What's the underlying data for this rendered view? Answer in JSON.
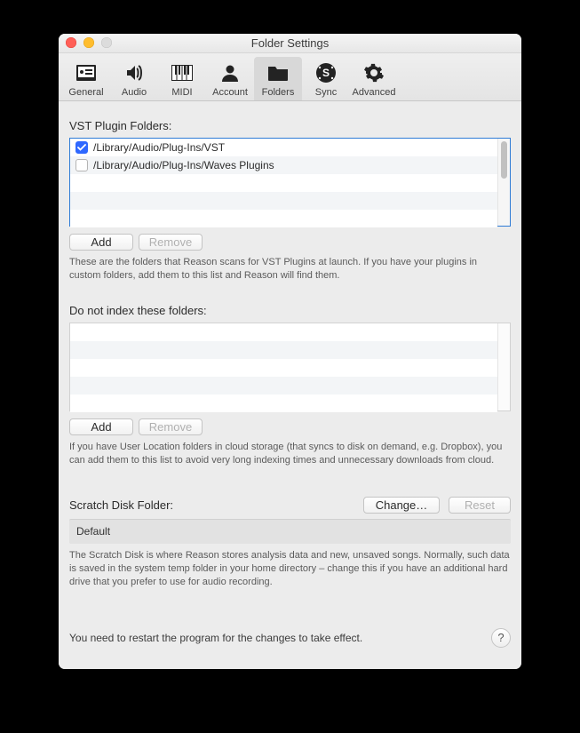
{
  "window": {
    "title": "Folder Settings"
  },
  "toolbar": {
    "items": [
      {
        "label": "General"
      },
      {
        "label": "Audio"
      },
      {
        "label": "MIDI"
      },
      {
        "label": "Account"
      },
      {
        "label": "Folders"
      },
      {
        "label": "Sync"
      },
      {
        "label": "Advanced"
      }
    ],
    "selected_index": 4
  },
  "vst": {
    "section_label": "VST Plugin Folders:",
    "rows": [
      {
        "checked": true,
        "path": "/Library/Audio/Plug-Ins/VST"
      },
      {
        "checked": false,
        "path": "/Library/Audio/Plug-Ins/Waves Plugins"
      }
    ],
    "add_label": "Add",
    "remove_label": "Remove",
    "hint": "These are the folders that Reason scans for VST Plugins at launch. If you have your plugins in custom folders, add them to this list and Reason will find them."
  },
  "noindex": {
    "section_label": "Do not index these folders:",
    "add_label": "Add",
    "remove_label": "Remove",
    "hint": "If you have User Location folders in cloud storage (that syncs to disk on demand, e.g. Dropbox), you can add them to this list to avoid very long indexing times and unnecessary downloads from cloud."
  },
  "scratch": {
    "section_label": "Scratch Disk Folder:",
    "change_label": "Change…",
    "reset_label": "Reset",
    "current": "Default",
    "hint": "The Scratch Disk is where Reason stores analysis data and new, unsaved songs. Normally, such data is saved in the system temp folder in your home directory – change this if you have an additional hard drive that you prefer to use for audio recording."
  },
  "restart_message": "You need to restart the program for the changes to take effect.",
  "help_label": "?"
}
